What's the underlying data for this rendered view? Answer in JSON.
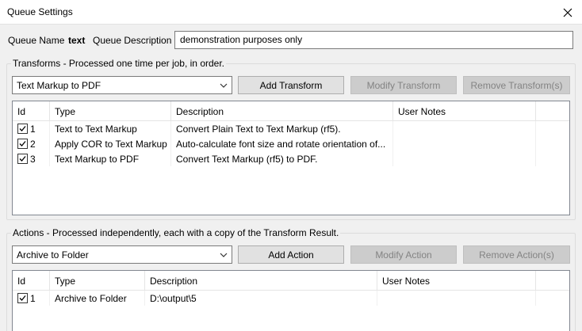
{
  "window": {
    "title": "Queue Settings"
  },
  "queue": {
    "name_label": "Queue Name",
    "name_value": "text",
    "description_label": "Queue Description",
    "description_value": "demonstration purposes only"
  },
  "transforms": {
    "group_title": "Transforms - Processed one time per job, in order.",
    "selected": "Text Markup to PDF",
    "add_label": "Add Transform",
    "modify_label": "Modify Transform",
    "remove_label": "Remove Transform(s)",
    "columns": [
      "Id",
      "Type",
      "Description",
      "User Notes"
    ],
    "rows": [
      {
        "checked": true,
        "id": "1",
        "type": "Text to Text Markup",
        "description": "Convert Plain Text to Text Markup (rf5).",
        "notes": ""
      },
      {
        "checked": true,
        "id": "2",
        "type": "Apply COR to Text Markup",
        "description": "Auto-calculate font size and rotate orientation of...",
        "notes": ""
      },
      {
        "checked": true,
        "id": "3",
        "type": "Text Markup to PDF",
        "description": "Convert Text Markup (rf5) to PDF.",
        "notes": ""
      }
    ]
  },
  "actions": {
    "group_title": "Actions - Processed independently, each with a copy of the Transform Result.",
    "selected": "Archive to Folder",
    "add_label": "Add Action",
    "modify_label": "Modify Action",
    "remove_label": "Remove Action(s)",
    "columns": [
      "Id",
      "Type",
      "Description",
      "User Notes"
    ],
    "rows": [
      {
        "checked": true,
        "id": "1",
        "type": "Archive to Folder",
        "description": "D:\\output\\5",
        "notes": ""
      }
    ]
  }
}
